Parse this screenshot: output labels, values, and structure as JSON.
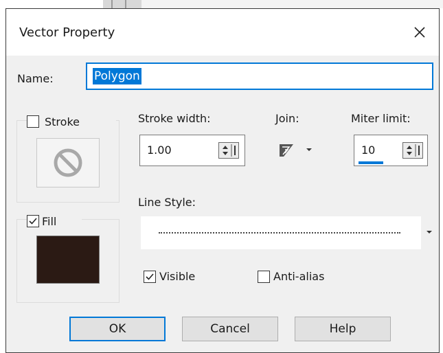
{
  "dialog": {
    "title": "Vector Property"
  },
  "name": {
    "label": "Name:",
    "value": "Polygon"
  },
  "stroke": {
    "checkbox_label": "Stroke",
    "checked": false,
    "swatch_icon": "none-icon"
  },
  "fill": {
    "checkbox_label": "Fill",
    "checked": true,
    "color": "#2b1a14"
  },
  "stroke_width": {
    "label": "Stroke width:",
    "value": "1.00"
  },
  "join": {
    "label": "Join:",
    "icon": "join-style-icon"
  },
  "miter_limit": {
    "label": "Miter limit:",
    "value": "10"
  },
  "line_style": {
    "label": "Line Style:"
  },
  "options": {
    "visible_label": "Visible",
    "visible_checked": true,
    "antialias_label": "Anti-alias",
    "antialias_checked": false
  },
  "buttons": {
    "ok": "OK",
    "cancel": "Cancel",
    "help": "Help"
  },
  "colors": {
    "accent": "#0078d7"
  }
}
